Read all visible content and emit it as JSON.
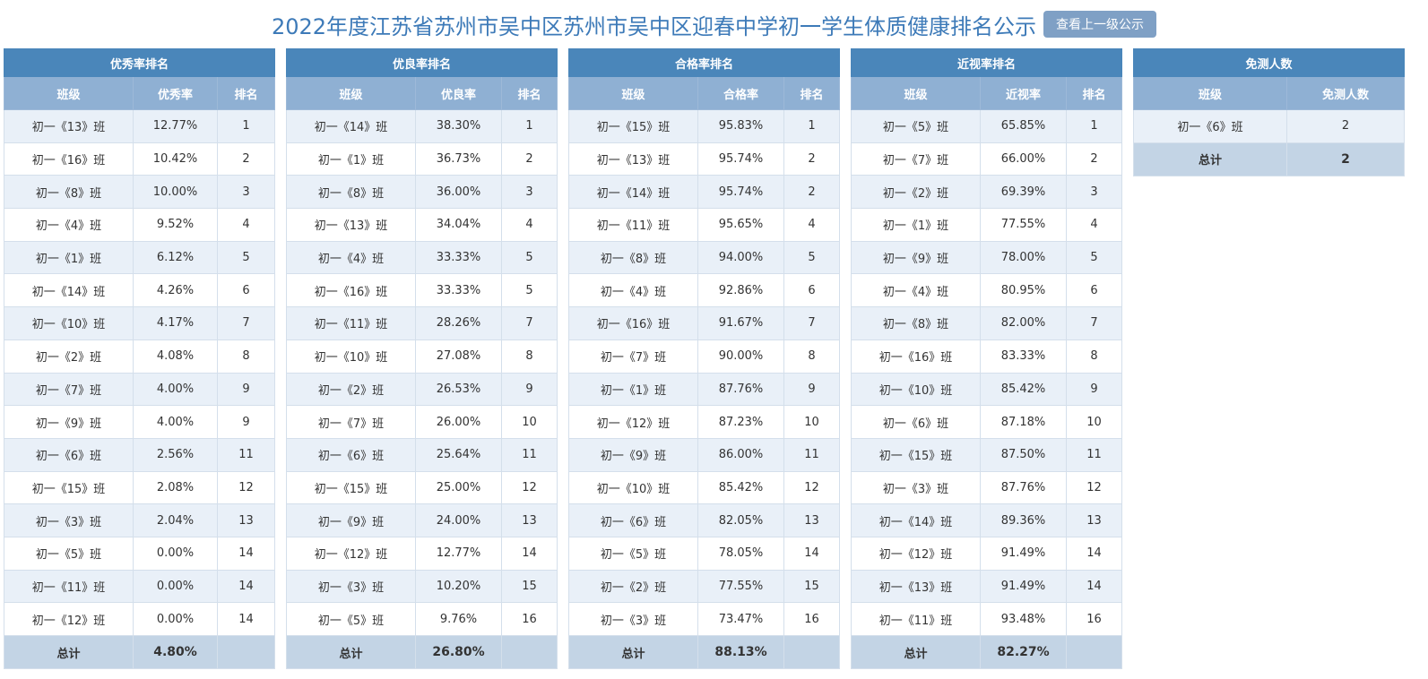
{
  "header": {
    "title": "2022年度江苏省苏州市吴中区苏州市吴中区迎春中学初一学生体质健康排名公示",
    "button": "查看上一级公示"
  },
  "tables": [
    {
      "caption": "优秀率排名",
      "headers": [
        "班级",
        "优秀率",
        "排名"
      ],
      "rows": [
        [
          "初一《13》班",
          "12.77%",
          "1"
        ],
        [
          "初一《16》班",
          "10.42%",
          "2"
        ],
        [
          "初一《8》班",
          "10.00%",
          "3"
        ],
        [
          "初一《4》班",
          "9.52%",
          "4"
        ],
        [
          "初一《1》班",
          "6.12%",
          "5"
        ],
        [
          "初一《14》班",
          "4.26%",
          "6"
        ],
        [
          "初一《10》班",
          "4.17%",
          "7"
        ],
        [
          "初一《2》班",
          "4.08%",
          "8"
        ],
        [
          "初一《7》班",
          "4.00%",
          "9"
        ],
        [
          "初一《9》班",
          "4.00%",
          "9"
        ],
        [
          "初一《6》班",
          "2.56%",
          "11"
        ],
        [
          "初一《15》班",
          "2.08%",
          "12"
        ],
        [
          "初一《3》班",
          "2.04%",
          "13"
        ],
        [
          "初一《5》班",
          "0.00%",
          "14"
        ],
        [
          "初一《11》班",
          "0.00%",
          "14"
        ],
        [
          "初一《12》班",
          "0.00%",
          "14"
        ]
      ],
      "total": [
        "总计",
        "4.80%",
        ""
      ]
    },
    {
      "caption": "优良率排名",
      "headers": [
        "班级",
        "优良率",
        "排名"
      ],
      "rows": [
        [
          "初一《14》班",
          "38.30%",
          "1"
        ],
        [
          "初一《1》班",
          "36.73%",
          "2"
        ],
        [
          "初一《8》班",
          "36.00%",
          "3"
        ],
        [
          "初一《13》班",
          "34.04%",
          "4"
        ],
        [
          "初一《4》班",
          "33.33%",
          "5"
        ],
        [
          "初一《16》班",
          "33.33%",
          "5"
        ],
        [
          "初一《11》班",
          "28.26%",
          "7"
        ],
        [
          "初一《10》班",
          "27.08%",
          "8"
        ],
        [
          "初一《2》班",
          "26.53%",
          "9"
        ],
        [
          "初一《7》班",
          "26.00%",
          "10"
        ],
        [
          "初一《6》班",
          "25.64%",
          "11"
        ],
        [
          "初一《15》班",
          "25.00%",
          "12"
        ],
        [
          "初一《9》班",
          "24.00%",
          "13"
        ],
        [
          "初一《12》班",
          "12.77%",
          "14"
        ],
        [
          "初一《3》班",
          "10.20%",
          "15"
        ],
        [
          "初一《5》班",
          "9.76%",
          "16"
        ]
      ],
      "total": [
        "总计",
        "26.80%",
        ""
      ]
    },
    {
      "caption": "合格率排名",
      "headers": [
        "班级",
        "合格率",
        "排名"
      ],
      "rows": [
        [
          "初一《15》班",
          "95.83%",
          "1"
        ],
        [
          "初一《13》班",
          "95.74%",
          "2"
        ],
        [
          "初一《14》班",
          "95.74%",
          "2"
        ],
        [
          "初一《11》班",
          "95.65%",
          "4"
        ],
        [
          "初一《8》班",
          "94.00%",
          "5"
        ],
        [
          "初一《4》班",
          "92.86%",
          "6"
        ],
        [
          "初一《16》班",
          "91.67%",
          "7"
        ],
        [
          "初一《7》班",
          "90.00%",
          "8"
        ],
        [
          "初一《1》班",
          "87.76%",
          "9"
        ],
        [
          "初一《12》班",
          "87.23%",
          "10"
        ],
        [
          "初一《9》班",
          "86.00%",
          "11"
        ],
        [
          "初一《10》班",
          "85.42%",
          "12"
        ],
        [
          "初一《6》班",
          "82.05%",
          "13"
        ],
        [
          "初一《5》班",
          "78.05%",
          "14"
        ],
        [
          "初一《2》班",
          "77.55%",
          "15"
        ],
        [
          "初一《3》班",
          "73.47%",
          "16"
        ]
      ],
      "total": [
        "总计",
        "88.13%",
        ""
      ]
    },
    {
      "caption": "近视率排名",
      "headers": [
        "班级",
        "近视率",
        "排名"
      ],
      "rows": [
        [
          "初一《5》班",
          "65.85%",
          "1"
        ],
        [
          "初一《7》班",
          "66.00%",
          "2"
        ],
        [
          "初一《2》班",
          "69.39%",
          "3"
        ],
        [
          "初一《1》班",
          "77.55%",
          "4"
        ],
        [
          "初一《9》班",
          "78.00%",
          "5"
        ],
        [
          "初一《4》班",
          "80.95%",
          "6"
        ],
        [
          "初一《8》班",
          "82.00%",
          "7"
        ],
        [
          "初一《16》班",
          "83.33%",
          "8"
        ],
        [
          "初一《10》班",
          "85.42%",
          "9"
        ],
        [
          "初一《6》班",
          "87.18%",
          "10"
        ],
        [
          "初一《15》班",
          "87.50%",
          "11"
        ],
        [
          "初一《3》班",
          "87.76%",
          "12"
        ],
        [
          "初一《14》班",
          "89.36%",
          "13"
        ],
        [
          "初一《12》班",
          "91.49%",
          "14"
        ],
        [
          "初一《13》班",
          "91.49%",
          "14"
        ],
        [
          "初一《11》班",
          "93.48%",
          "16"
        ]
      ],
      "total": [
        "总计",
        "82.27%",
        ""
      ]
    },
    {
      "caption": "免测人数",
      "headers": [
        "班级",
        "免测人数"
      ],
      "rows": [
        [
          "初一《6》班",
          "2"
        ]
      ],
      "total": [
        "总计",
        "2"
      ]
    }
  ],
  "colors": {
    "title": "#3d7ab8",
    "caption_bg": "#4a86ba",
    "header_bg": "#8fb0d3",
    "row_alt": "#e9f0f8",
    "total_bg": "#c3d4e5",
    "button_bg": "#7fa0c5"
  }
}
